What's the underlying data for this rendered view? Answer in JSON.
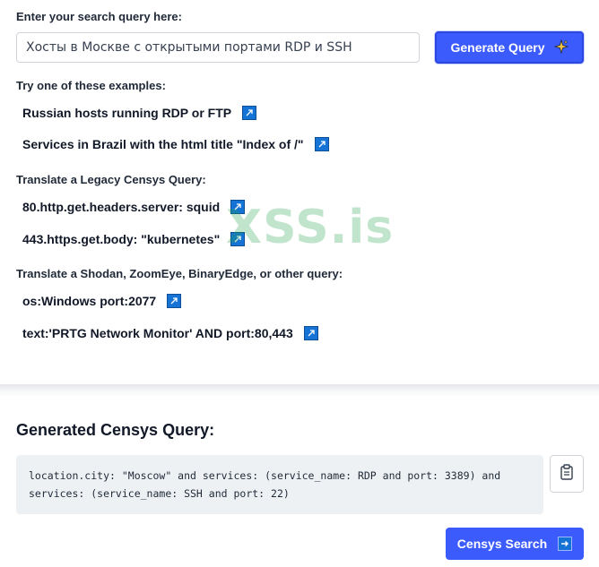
{
  "search": {
    "label": "Enter your search query here:",
    "value": "Хосты в Москве с открытыми портами RDP и SSH",
    "button_label": "Generate Query",
    "button_icon": "sparkle-icon"
  },
  "examples_section": {
    "heading": "Try one of these examples:",
    "items": [
      {
        "label": "Russian hosts running RDP or FTP",
        "icon": "external-link-icon"
      },
      {
        "label": "Services in Brazil with the html title \"Index of /\"",
        "icon": "external-link-icon"
      }
    ]
  },
  "legacy_section": {
    "heading": "Translate a Legacy Censys Query:",
    "items": [
      {
        "label": "80.http.get.headers.server: squid",
        "icon": "external-link-icon"
      },
      {
        "label": "443.https.get.body: \"kubernetes\"",
        "icon": "external-link-icon"
      }
    ]
  },
  "other_section": {
    "heading": "Translate a Shodan, ZoomEye, BinaryEdge, or other query:",
    "items": [
      {
        "label": "os:Windows port:2077",
        "icon": "external-link-icon"
      },
      {
        "label": "text:'PRTG Network Monitor' AND port:80,443",
        "icon": "external-link-icon"
      }
    ]
  },
  "watermark": "XSS.is",
  "result": {
    "title": "Generated Censys Query:",
    "line1": "location.city: \"Moscow\" and services: (service_name: RDP and port: 3389) and",
    "line2": "services: (service_name: SSH and port: 22)",
    "copy_icon": "clipboard-icon",
    "censys_button_label": "Censys Search",
    "censys_button_icon": "arrow-right-icon"
  },
  "colors": {
    "accent": "#3b5bfd",
    "link_icon": "#1673d6",
    "code_bg": "#eef1f4",
    "watermark": "#1fa34a"
  }
}
